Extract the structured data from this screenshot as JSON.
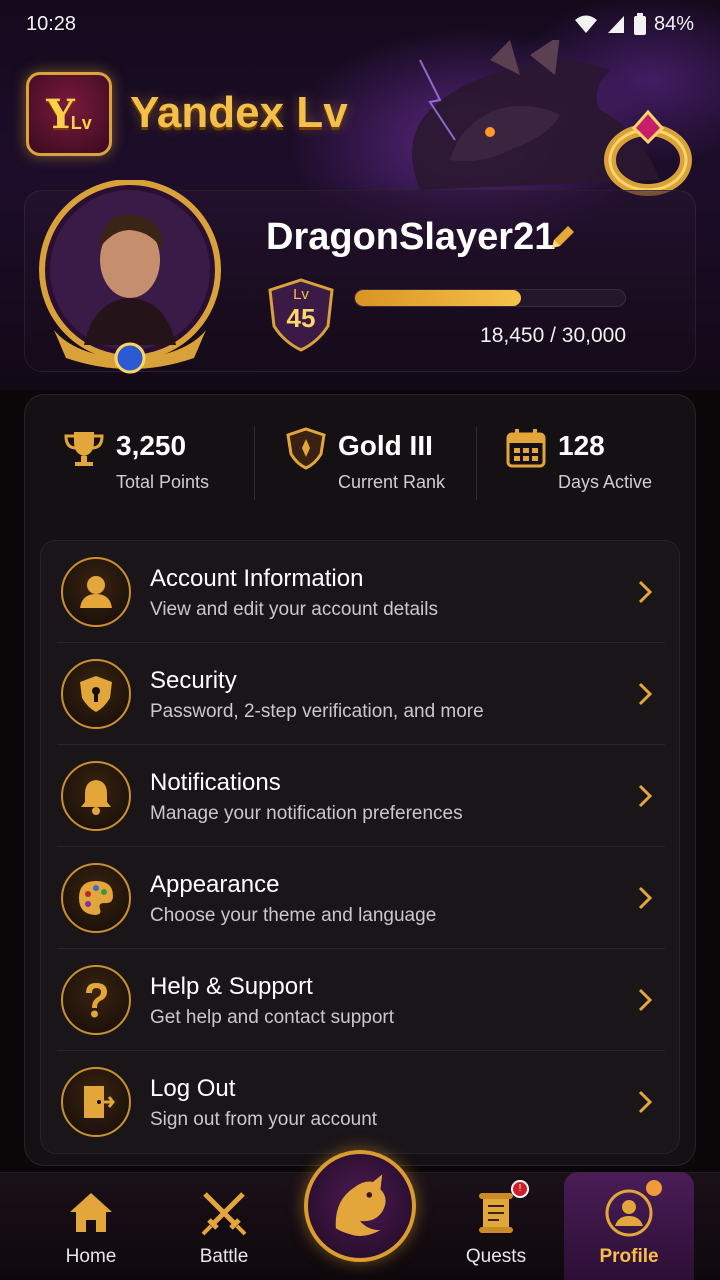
{
  "status_bar": {
    "time": "10:28",
    "battery": "84%"
  },
  "app": {
    "title": "Yandex Lv",
    "logo_text": "Y",
    "logo_sub": "Lv"
  },
  "profile": {
    "username": "DragonSlayer21",
    "level_prefix": "Lv",
    "level": "45",
    "xp_text": "18,450 / 30,000",
    "xp_fraction": 0.615
  },
  "stats": [
    {
      "value": "3,250",
      "label": "Total Points",
      "icon": "trophy-icon"
    },
    {
      "value": "Gold III",
      "label": "Current Rank",
      "icon": "rank-shield-icon"
    },
    {
      "value": "128",
      "label": "Days Active",
      "icon": "calendar-icon"
    }
  ],
  "menu": [
    {
      "title": "Account Information",
      "subtitle": "View and edit your account details",
      "icon": "user-icon"
    },
    {
      "title": "Security",
      "subtitle": "Password, 2-step verification, and more",
      "icon": "lock-shield-icon"
    },
    {
      "title": "Notifications",
      "subtitle": "Manage your notification preferences",
      "icon": "bell-icon"
    },
    {
      "title": "Appearance",
      "subtitle": "Choose your theme and language",
      "icon": "palette-icon"
    },
    {
      "title": "Help & Support",
      "subtitle": "Get help and contact support",
      "icon": "question-icon"
    },
    {
      "title": "Log Out",
      "subtitle": "Sign out from your account",
      "icon": "door-exit-icon"
    }
  ],
  "nav": {
    "home": "Home",
    "battle": "Battle",
    "quests": "Quests",
    "profile": "Profile",
    "quests_badge": "!"
  },
  "colors": {
    "gold": "#f4c04a",
    "accent_purple": "#4a1d57",
    "background": "#0b0709"
  }
}
